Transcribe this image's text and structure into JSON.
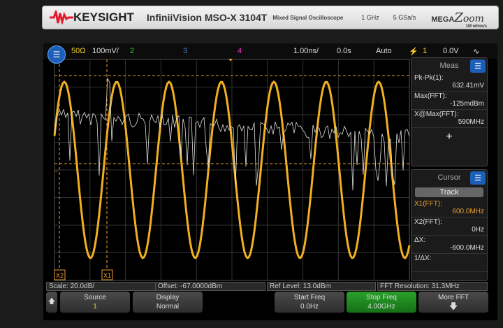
{
  "header": {
    "brand": "KEYSIGHT",
    "model": "InfiniiVision MSO-X 3104T",
    "subtitle": "Mixed Signal Oscilloscope",
    "bandwidth": "1 GHz",
    "sample_rate": "5 GSa/s",
    "megazoom_prefix": "MEGA",
    "megazoom_z": "Z",
    "megazoom_suffix": "oom",
    "megazoom_rate": "1M wfms/s"
  },
  "topbar": {
    "ch1_impedance": "50Ω",
    "ch1_scale": "100mV/",
    "ch2": "2",
    "ch3": "3",
    "ch4": "4",
    "timebase": "1.00ns/",
    "delay": "0.0s",
    "trigger_mode": "Auto",
    "trigger_source": "1",
    "trigger_level": "0.0V"
  },
  "meas": {
    "title": "Meas",
    "items": [
      {
        "label": "Pk-Pk(1):",
        "value": "632.41mV"
      },
      {
        "label": "Max(FFT):",
        "value": "-125mdBm"
      },
      {
        "label": "X@Max(FFT):",
        "value": "590MHz"
      }
    ],
    "add": "+"
  },
  "cursor": {
    "title": "Cursor",
    "mode": "Track",
    "items": [
      {
        "label": "X1(FFT):",
        "value": "600.0MHz"
      },
      {
        "label": "X2(FFT):",
        "value": "0Hz"
      },
      {
        "label": "ΔX:",
        "value": "-600.0MHz"
      },
      {
        "label": "1/ΔX:",
        "value": ""
      }
    ]
  },
  "markers": {
    "x1": "X1",
    "x2": "X2",
    "ground": "1"
  },
  "status": {
    "scale": "Scale: 20.0dB/",
    "offset": "Offset: -67.0000dBm",
    "ref": "Ref Level: 13.0dBm",
    "res": "FFT Resolution: 31.3MHz"
  },
  "softkeys": {
    "source_label": "Source",
    "source_value": "1",
    "display_label": "Display",
    "display_value": "Normal",
    "start_label": "Start Freq",
    "start_value": "0.0Hz",
    "stop_label": "Stop Freq",
    "stop_value": "4.00GHz",
    "more_label": "More FFT"
  },
  "colors": {
    "ch1": "#f0b020",
    "ch2": "#3c3",
    "ch3": "#36c",
    "ch4": "#e3c",
    "cursor": "#e8a030",
    "fft": "#e0e0e0"
  }
}
